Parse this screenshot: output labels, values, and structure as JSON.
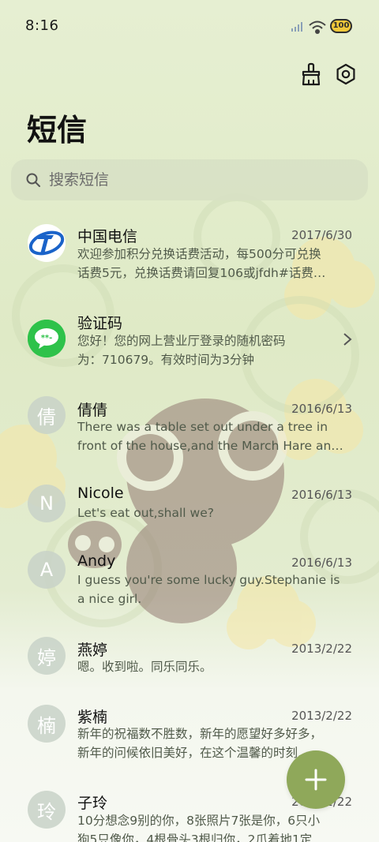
{
  "status_bar": {
    "time": "8:16",
    "battery": "100"
  },
  "header": {
    "title": "短信"
  },
  "search": {
    "placeholder": "搜索短信"
  },
  "messages": [
    {
      "sender": "中国电信",
      "date": "2017/6/30",
      "line1": "欢迎参加积分兑换话费活动，每500分可兑换",
      "line2": "话费5元，兑换话费请回复106或jfdh#话费…",
      "avatar_icon": "china-telecom-logo"
    },
    {
      "sender": "验证码",
      "date": "",
      "line1": "您好！您的网上营业厅登录的随机密码",
      "line2": "为：710679。有效时间为3分钟",
      "avatar_icon": "chat-bubble-icon"
    },
    {
      "sender": "倩倩",
      "date": "2016/6/13",
      "line1": "There was a table set out under a tree in",
      "line2": "front of the house,and the March Hare an…",
      "avatar_text": "倩"
    },
    {
      "sender": "Nicole",
      "date": "2016/6/13",
      "line1": "Let's eat out,shall we?",
      "line2": "",
      "avatar_text": "N"
    },
    {
      "sender": "Andy",
      "date": "2016/6/13",
      "line1": "I guess you're some lucky guy.Stephanie is",
      "line2": "a nice girl.",
      "avatar_text": "A"
    },
    {
      "sender": "燕婷",
      "date": "2013/2/22",
      "line1": "嗯。收到啦。同乐同乐。",
      "line2": "",
      "avatar_text": "婷"
    },
    {
      "sender": "紫楠",
      "date": "2013/2/22",
      "line1": "新年的祝福数不胜数，新年的愿望好多好多，",
      "line2": "新年的问候依旧美好，在这个温馨的时刻…",
      "avatar_text": "楠"
    },
    {
      "sender": "子玲",
      "date": "2013/2/22",
      "line1": "10分想念9别的你，8张照片7张是你，6只小",
      "line2": "狗5只像你，4根骨头3根归你，2爪着地1定",
      "avatar_text": "玲"
    }
  ],
  "colors": {
    "fab": "#8fa85a",
    "wechat_green": "#2ec24a",
    "telecom_blue": "#1a63c9"
  }
}
